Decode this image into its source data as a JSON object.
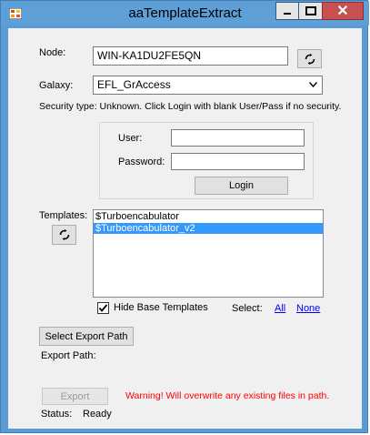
{
  "window": {
    "title": "aaTemplateExtract",
    "min_glyph": "▁",
    "max_glyph": "□",
    "close_glyph": "✕"
  },
  "node": {
    "label": "Node:",
    "value": "WIN-KA1DU2FE5QN"
  },
  "galaxy": {
    "label": "Galaxy:",
    "value": "EFL_GrAccess"
  },
  "security": {
    "text": "Security type:  Unknown. Click Login with blank User/Pass if no security."
  },
  "login": {
    "user_label": "User:",
    "password_label": "Password:",
    "user_value": "",
    "password_value": "",
    "button_label": "Login"
  },
  "templates": {
    "label": "Templates:",
    "items": [
      "$Turboencabulator",
      "$Turboencabulator_v2"
    ],
    "selected_index": 1
  },
  "options": {
    "hide_base_label": "Hide Base Templates",
    "hide_base_checked": true,
    "select_label": "Select:",
    "all_label": "All",
    "none_label": "None"
  },
  "export": {
    "path_button_label": "Select Export Path",
    "path_label": "Export Path:",
    "export_button_label": "Export",
    "warning": "Warning! Will overwrite any existing files in path."
  },
  "status": {
    "label": "Status:",
    "value": "Ready"
  },
  "colors": {
    "titlebar": "#5d9fd6",
    "selection": "#3399ff",
    "warning": "#ff0000",
    "link": "#0000ff"
  }
}
